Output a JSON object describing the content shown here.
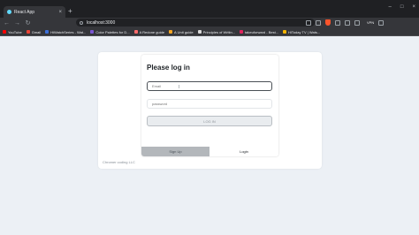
{
  "browser": {
    "tab_title": "React App",
    "tab_close": "×",
    "new_tab": "+",
    "window_controls": [
      "–",
      "□",
      "×"
    ],
    "nav": {
      "back": "←",
      "forward": "→",
      "reload": "↻"
    },
    "url": "localhost:3000",
    "vpn_label": "VPN",
    "bookmarks": [
      {
        "label": "YouTube",
        "color": "#ff0000"
      },
      {
        "label": "Gmail",
        "color": "#ea4335"
      },
      {
        "label": "HiWatchSeries - Wat...",
        "color": "#3c6fd8"
      },
      {
        "label": "Color Palettes for D...",
        "color": "#7a55d1"
      },
      {
        "label": "A Redone guide",
        "color": "#ff6b6b"
      },
      {
        "label": "A Unit guide",
        "color": "#f5a623"
      },
      {
        "label": "Principles of Writin...",
        "color": "#d9d9d9"
      },
      {
        "label": "takeuforward - Best...",
        "color": "#e0245e"
      },
      {
        "label": "HiToday TV | Wats...",
        "color": "#f4b400"
      }
    ]
  },
  "login_form": {
    "title": "Please log in",
    "email_placeholder": "Email",
    "password_placeholder": "password",
    "login_button": "LOG IN",
    "tab_signup": "Sign Up",
    "tab_login": "Login"
  },
  "footer": {
    "text": "Chromer coding LLC"
  }
}
